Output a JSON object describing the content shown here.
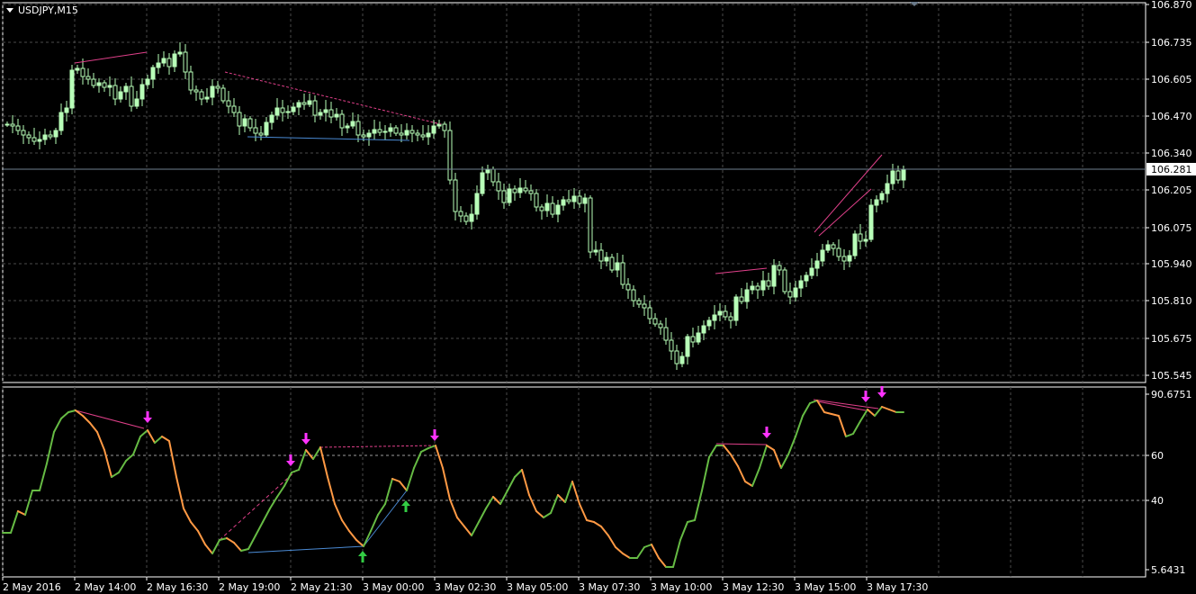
{
  "window": {
    "title": "USDJPY,M15",
    "collapse_icon": "triangle-down-icon",
    "shift_marker_icon": "triangle-down-icon"
  },
  "colors": {
    "background": "#000000",
    "grid": "#4a4a4a",
    "axis_text": "#ffffff",
    "bull_candle": "#b8ffb8",
    "bear_candle": "#000000",
    "wick": "#b8ffb8",
    "bid_line": "#708090",
    "bid_label_bg": "#ffffff",
    "bid_label_text": "#000000",
    "osc_up": "#66bb44",
    "osc_down": "#ff9944",
    "div_bear": "#e0408a",
    "div_bull": "#4a8ad4",
    "arrow_down": "#ff33ff",
    "arrow_up": "#33cc44"
  },
  "price_axis": {
    "labels": [
      "106.870",
      "106.735",
      "106.605",
      "106.470",
      "106.340",
      "106.205",
      "106.075",
      "105.940",
      "105.810",
      "105.675",
      "105.545"
    ],
    "current_price": "106.281"
  },
  "oscillator_axis": {
    "labels": [
      "90.6751",
      "60",
      "40",
      "5.6431"
    ]
  },
  "time_axis": {
    "labels": [
      "2 May 2016",
      "2 May 14:00",
      "2 May 16:30",
      "2 May 19:00",
      "2 May 21:30",
      "3 May 00:00",
      "3 May 02:30",
      "3 May 05:00",
      "3 May 07:30",
      "3 May 10:00",
      "3 May 12:30",
      "3 May 15:00",
      "3 May 17:30"
    ]
  }
}
